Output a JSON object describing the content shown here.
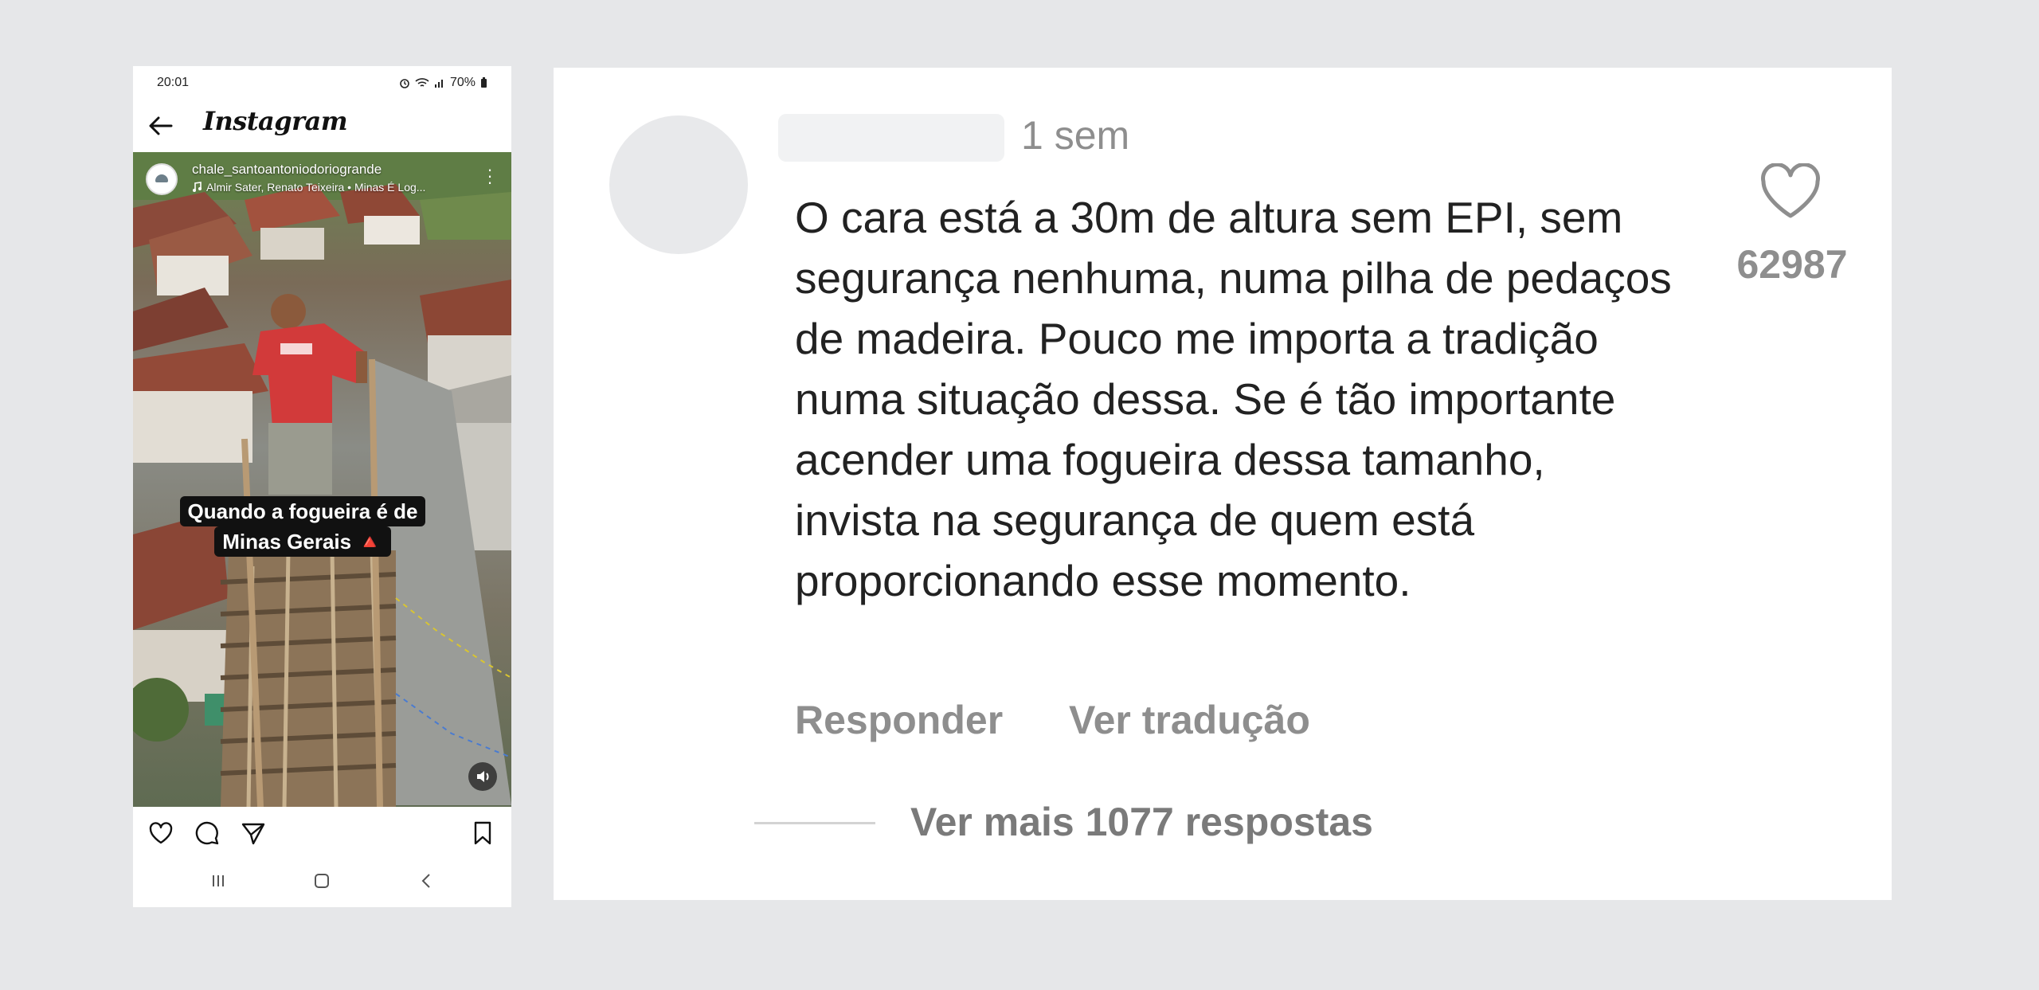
{
  "phone": {
    "status": {
      "time": "20:01",
      "battery": "70%"
    },
    "header": {
      "app_name": "Instagram"
    },
    "post": {
      "username": "chale_santoantoniodoriogrande",
      "music": "Almir Sater, Renato Teixeira • Minas É Log...",
      "caption_line1": "Quando a fogueira é de",
      "caption_line2": "Minas Gerais 🔺"
    },
    "icons": {
      "back": "arrow-left-icon",
      "like": "heart-icon",
      "comment": "comment-icon",
      "share": "send-icon",
      "save": "bookmark-icon",
      "more": "more-vertical-icon",
      "sound": "speaker-icon"
    }
  },
  "comment": {
    "time_ago": "1 sem",
    "text": "O cara está a 30m de altura sem EPI, sem segurança nenhuma, numa pilha de pedaços de madeira. Pouco me importa a tradição numa situação dessa. Se é tão importante acender uma fogueira dessa tamanho, invista na segurança de quem está proporcionando esse momento.",
    "likes": "62987",
    "reply_label": "Responder",
    "translate_label": "Ver tradução",
    "more_replies_label": "Ver mais 1077 respostas"
  },
  "colors": {
    "background": "#e6e7e9",
    "card": "#ffffff",
    "muted_text": "#8e8e8e",
    "body_text": "#222222"
  }
}
